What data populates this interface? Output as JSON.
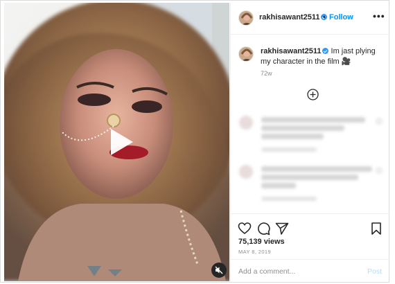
{
  "post": {
    "username": "rakhisawant2511",
    "separator": "•",
    "follow_label": "Follow",
    "more_label": "•••",
    "caption_user": "rakhisawant2511",
    "caption_text": "Im jast plying my character in the film 🎥",
    "age": "72w",
    "views": "75,139 views",
    "date": "MAY 8, 2019"
  },
  "comment_box": {
    "placeholder": "Add a comment...",
    "post_label": "Post"
  },
  "icons": {
    "play": "play-icon",
    "mute": "muted-speaker-icon",
    "load_more": "plus-circle-icon",
    "like": "heart-icon",
    "comment": "comment-bubble-icon",
    "share": "paper-plane-icon",
    "save": "bookmark-icon",
    "verified": "verified-badge-icon"
  },
  "colors": {
    "accent": "#0095f6",
    "verified": "#3897f0",
    "post_disabled": "#b2dffc",
    "muted_text": "#8e8e8e"
  }
}
